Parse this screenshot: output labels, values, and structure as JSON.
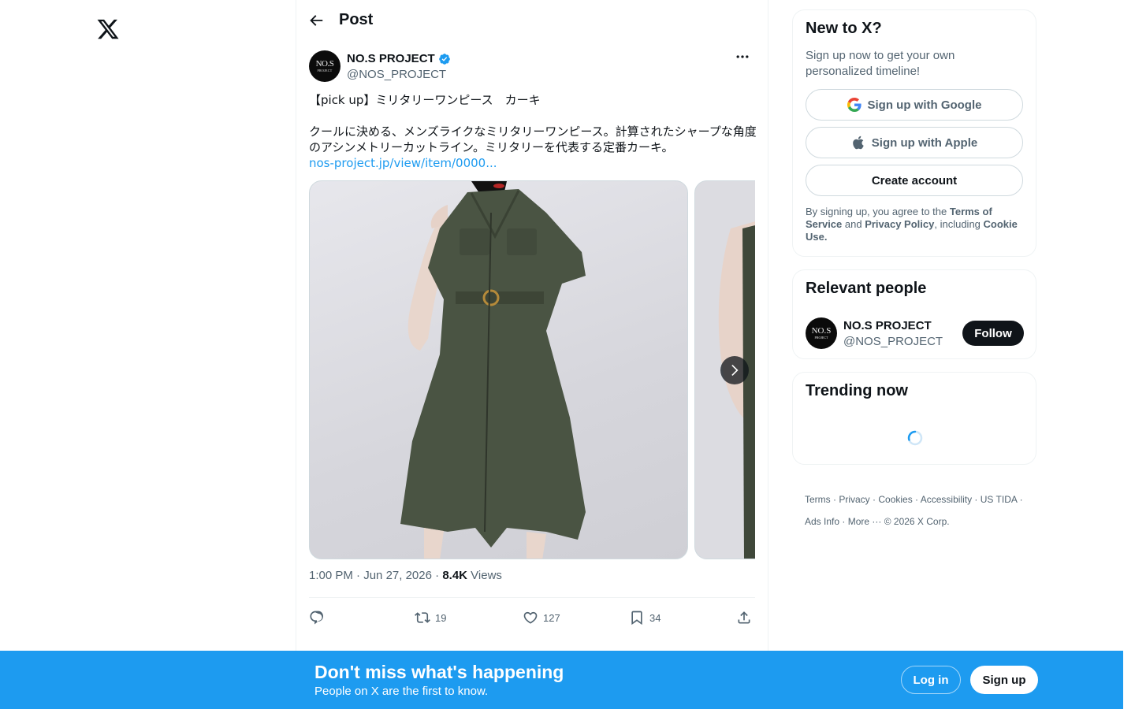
{
  "nav": {
    "logo_icon": "x-logo-icon"
  },
  "header": {
    "title": "Post",
    "back_icon": "arrow-left-icon"
  },
  "tweet": {
    "author": {
      "name": "NO.S PROJECT",
      "handle": "@NOS_PROJECT",
      "avatar_text_main": "NO.S",
      "avatar_text_sub": "PROJECT",
      "verified": true
    },
    "text_line1": "【pick up】ミリタリーワンピース　カーキ",
    "text_body": "クールに決める、メンズライクなミリタリーワンピース。計算されたシャープな角度のアシンメトリーカットライン。ミリタリーを代表する定番カーキ。",
    "link_text": "nos-project.jp/view/item/0000...",
    "time": "1:00 PM",
    "date": "Jun 27, 2026",
    "views_count": "8.4K",
    "views_label": "Views",
    "stats": {
      "replies": "",
      "reposts": "19",
      "likes": "127",
      "bookmarks": "34"
    }
  },
  "signup_card": {
    "title": "New to X?",
    "subtitle": "Sign up now to get your own personalized timeline!",
    "google_label": "Sign up with Google",
    "apple_label": "Sign up with Apple",
    "create_label": "Create account",
    "legal_pre": "By signing up, you agree to the ",
    "legal_terms": "Terms of Service",
    "legal_and": " and ",
    "legal_privacy": "Privacy Policy",
    "legal_including": ", including ",
    "legal_cookie": "Cookie Use."
  },
  "people_card": {
    "title": "Relevant people",
    "name": "NO.S PROJECT",
    "handle": "@NOS_PROJECT",
    "follow_label": "Follow"
  },
  "trending_card": {
    "title": "Trending now"
  },
  "footer": {
    "links": [
      "Terms",
      "Privacy",
      "Cookies",
      "Accessibility",
      "US TIDA",
      "Ads Info",
      "More ···"
    ],
    "copyright": "© 2026 X Corp."
  },
  "banner": {
    "title": "Don't miss what's happening",
    "subtitle": "People on X are the first to know.",
    "login_label": "Log in",
    "signup_label": "Sign up"
  },
  "colors": {
    "accent": "#1d9bf0",
    "text": "#0f1419",
    "muted": "#536471",
    "border": "#eff3f4",
    "dress": "#4a5443"
  }
}
